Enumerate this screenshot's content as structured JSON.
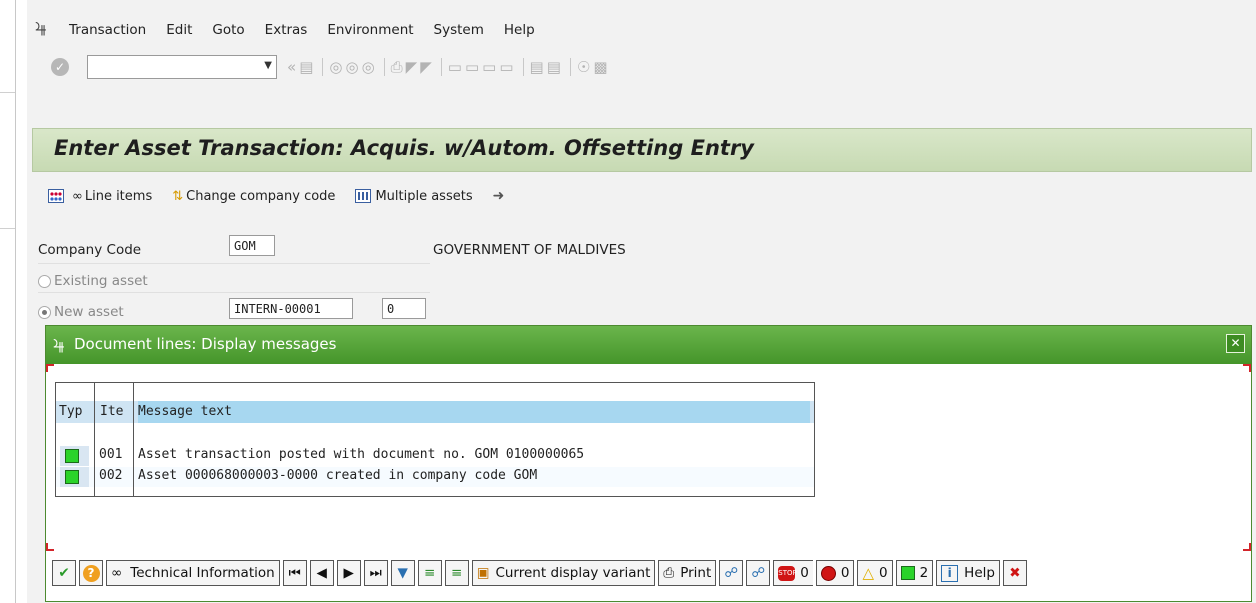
{
  "menubar": {
    "items": [
      "Transaction",
      "Edit",
      "Goto",
      "Extras",
      "Environment",
      "System",
      "Help"
    ]
  },
  "toolbar": {
    "command_field_value": "",
    "icons": [
      "enter-icon",
      "save-icon",
      "back-icon",
      "exit-icon",
      "cancel-icon",
      "print-icon",
      "find-icon",
      "find-next-icon",
      "first-page-icon",
      "previous-page-icon",
      "next-page-icon",
      "last-page-icon",
      "new-session-icon",
      "shortcut-icon",
      "help-icon",
      "layout-icon"
    ]
  },
  "title": "Enter Asset Transaction: Acquis. w/Autom. Offsetting Entry",
  "app_toolbar": {
    "line_items": "Line items",
    "change_company_code": "Change company code",
    "multiple_assets": "Multiple assets"
  },
  "form": {
    "company_code_label": "Company Code",
    "company_code_value": "GOM",
    "company_name": "GOVERNMENT OF MALDIVES",
    "existing_asset_label": "Existing asset",
    "new_asset_label": "New asset",
    "new_asset_value": "INTERN-00001",
    "new_asset_sub": "0"
  },
  "popup": {
    "title": "Document lines: Display messages",
    "columns": {
      "typ": "Typ",
      "ite": "Ite",
      "msg": "Message text"
    },
    "messages": [
      {
        "item": "001",
        "text": "Asset transaction posted with document no. GOM 0100000065",
        "status": "success"
      },
      {
        "item": "002",
        "text": "Asset 000068000003-0000 created in company code GOM",
        "status": "success"
      }
    ],
    "footer": {
      "technical_info": "Technical Information",
      "current_display_variant": "Current display variant",
      "print": "Print",
      "stop_count": "0",
      "error_count": "0",
      "warning_count": "0",
      "success_count": "2",
      "help": "Help"
    }
  },
  "colors": {
    "popup_header": "#4f9f34",
    "title_bar": "#d3e3c2",
    "table_header": "#a7d7f0",
    "success": "#2ad32a"
  }
}
